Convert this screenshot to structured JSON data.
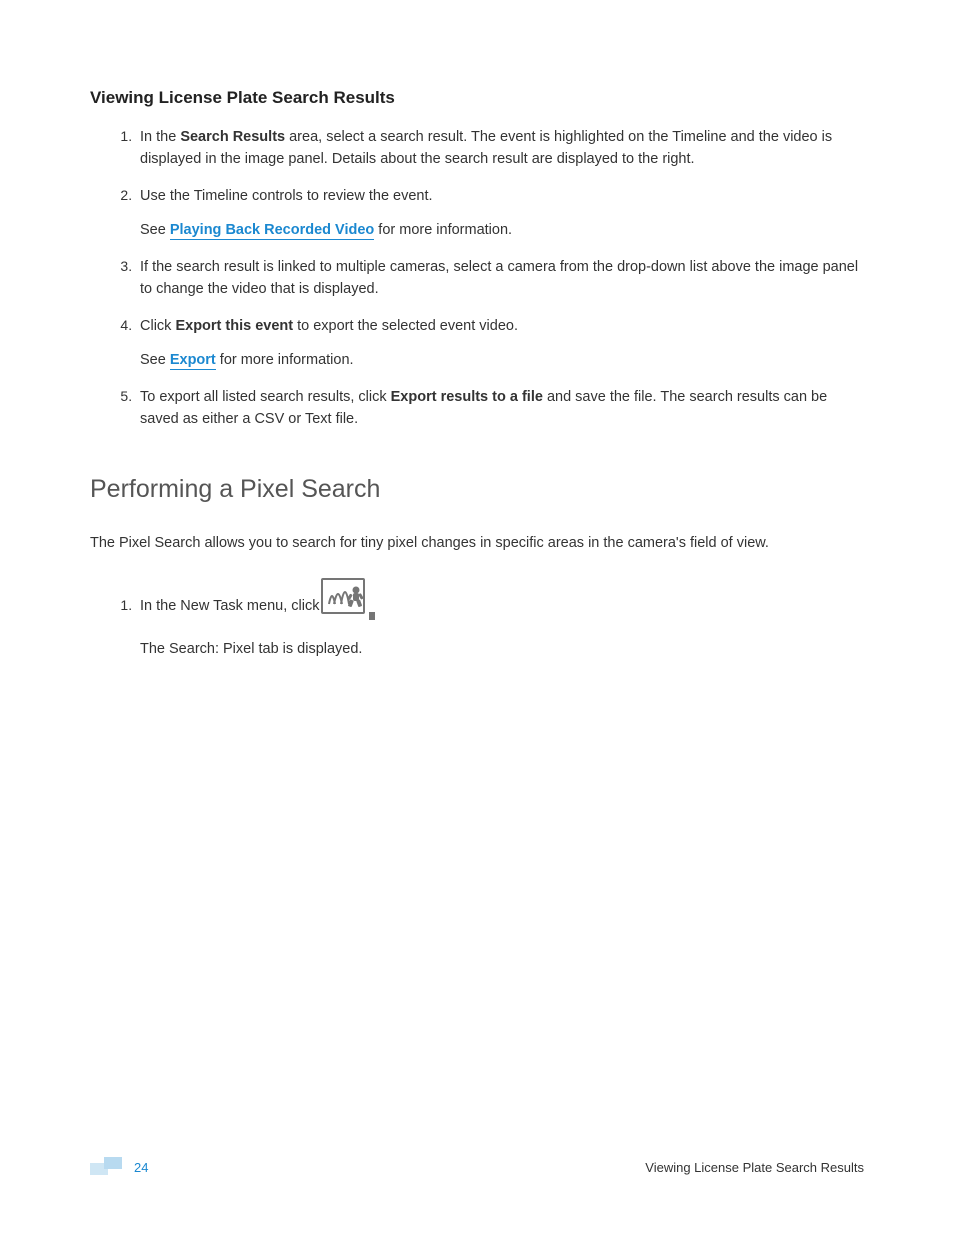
{
  "heading1": "Viewing License Plate Search Results",
  "steps1": [
    {
      "pre": "In the ",
      "bold1": "Search Results",
      "post": " area, select a search result. The event is highlighted on the Timeline and the video is displayed in the image panel. Details about the search result are displayed to the right."
    },
    {
      "text": "Use the Timeline controls to review the event.",
      "sub_pre": "See ",
      "sub_link": "Playing Back Recorded Video",
      "sub_post": " for more information."
    },
    {
      "text": "If the search result is linked to multiple cameras, select a camera from the drop-down list above the image panel to change the video that is displayed."
    },
    {
      "pre": "Click ",
      "bold1": "Export this event",
      "post": " to export the selected event video.",
      "sub_pre": "See ",
      "sub_link": "Export",
      "sub_post": " for more information."
    },
    {
      "pre": "To export all listed search results, click ",
      "bold1": "Export results to a file",
      "post": " and save the file. The search results can be saved as either a CSV or Text file."
    }
  ],
  "heading2": "Performing a Pixel Search",
  "intro2": "The Pixel Search allows you to search for tiny pixel changes in specific areas in the camera's field of view.",
  "steps2": [
    {
      "pre": "In the New Task menu, click ",
      "sub_text": "The Search: Pixel tab is displayed."
    }
  ],
  "footer": {
    "page_number": "24",
    "title": "Viewing License Plate Search Results"
  }
}
